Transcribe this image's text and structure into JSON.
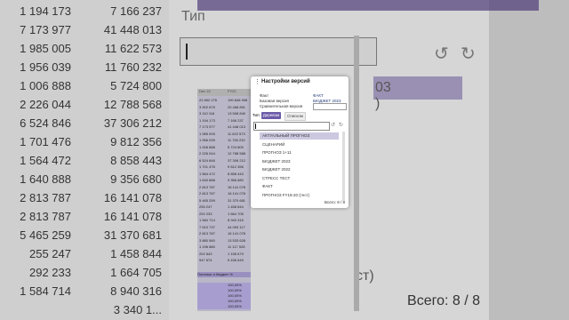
{
  "background": {
    "table_rows": [
      [
        "1 194 173",
        "7 166 237"
      ],
      [
        "7 173 977",
        "41 448 013"
      ],
      [
        "1 985 005",
        "11 622 573"
      ],
      [
        "1 956 039",
        "11 760 232"
      ],
      [
        "1 006 888",
        "5 724 800"
      ],
      [
        "2 226 044",
        "12 788 568"
      ],
      [
        "6 524 846",
        "37 306 212"
      ],
      [
        "1 701 476",
        "9 812 356"
      ],
      [
        "1 564 472",
        "8 858 443"
      ],
      [
        "1 640 888",
        "9 356 680"
      ],
      [
        "2 813 787",
        "16 141 078"
      ],
      [
        "2 813 787",
        "16 141 078"
      ],
      [
        "5 465 259",
        "31 370 681"
      ],
      [
        "255 247",
        "1 458 844"
      ],
      [
        "292 233",
        "1 664 705"
      ],
      [
        "1 584 714",
        "8 940 316"
      ],
      [
        "",
        "3 340 1..."
      ]
    ],
    "tip_label": "Тип",
    "number_fragment": "03",
    "paren_fragment": ")",
    "tail_fragment": "ст)",
    "total_label": "Всего: 8 / 8"
  },
  "mini_table": {
    "header": [
      "Dec 22",
      "FY22"
    ],
    "rows": [
      [
        "22 852 276",
        "190 848 998"
      ],
      [
        "3 902 675",
        "20 468 891"
      ],
      [
        "3 110 116",
        "13 508 840"
      ],
      [
        "1 194 173",
        "7 166 237"
      ],
      [
        "7 173 977",
        "41 448 013"
      ],
      [
        "1 985 005",
        "11 622 573"
      ],
      [
        "1 956 039",
        "11 760 232"
      ],
      [
        "1 006 888",
        "5 724 800"
      ],
      [
        "2 226 044",
        "12 788 568"
      ],
      [
        "6 524 846",
        "37 306 212"
      ],
      [
        "1 701 476",
        "9 812 356"
      ],
      [
        "1 564 472",
        "8 858 443"
      ],
      [
        "1 640 888",
        "9 356 680"
      ],
      [
        "2 813 787",
        "16 141 078"
      ],
      [
        "2 813 787",
        "16 141 078"
      ],
      [
        "5 465 259",
        "31 370 681"
      ],
      [
        "255 247",
        "1 458 844"
      ],
      [
        "292 233",
        "1 664 705"
      ],
      [
        "1 584 714",
        "8 940 316"
      ],
      [
        "7 610 737",
        "44 093 117"
      ],
      [
        "2 813 787",
        "16 141 078"
      ],
      [
        "3 880 560",
        "13 533 628"
      ],
      [
        "1 196 880",
        "11 117 528"
      ],
      [
        "202 843",
        "1 158 679"
      ],
      [
        "947 874",
        "5 436 649"
      ]
    ],
    "footer_label": "Плотные и бюджет %",
    "footer_values": [
      "100,00%",
      "100,00%",
      "100,00%",
      "100,00%",
      "100,00%"
    ]
  },
  "modal": {
    "title": "Настройки версий",
    "fields": [
      {
        "label": "Факт",
        "value": "ФАКТ"
      },
      {
        "label": "Базовая версия",
        "value": "БЮДЖЕТ 2023"
      },
      {
        "label": "Сравнительная версия",
        "value": ""
      }
    ],
    "type_label": "Тип:",
    "tabs": [
      {
        "label": "Деревом",
        "active": true
      },
      {
        "label": "Списком",
        "active": false
      }
    ],
    "search_value": "",
    "items": [
      "АКТУАЛЬНЫЙ ПРОГНОЗ",
      "СЦЕНАРИЙ",
      "ПРОГНОЗ 1+11",
      "БЮДЖЕТ 2023",
      "БЮДЖЕТ 2022",
      "СТРЕСС ТЕСТ",
      "ФАКТ",
      "ПРОГНОЗ FY19-20 (тест)"
    ],
    "selected_index": 0,
    "count_label": "Всего: 8 / 8"
  },
  "colors": {
    "accent": "#6b5aa8",
    "selected": "#ccc8e0",
    "link": "#1f3a7a"
  }
}
